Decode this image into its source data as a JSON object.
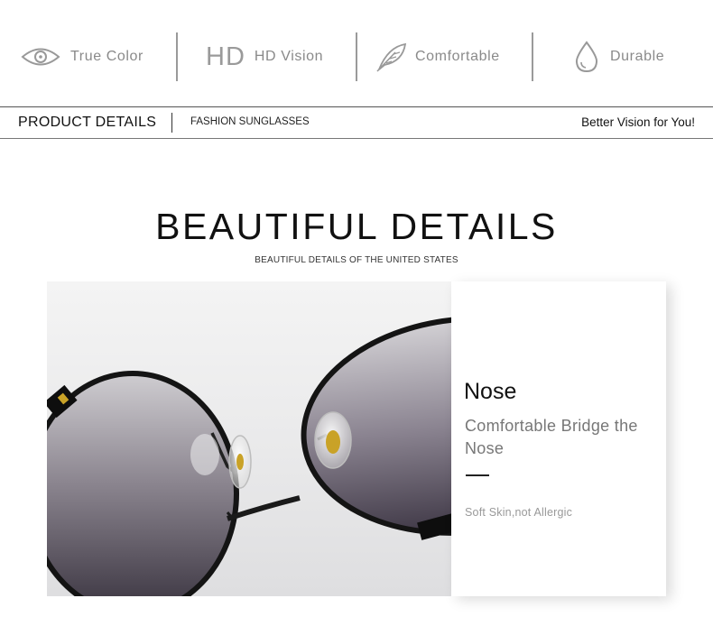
{
  "features": [
    {
      "icon": "eye-icon",
      "label": "True Color"
    },
    {
      "icon": "hd-icon",
      "mark": "HD",
      "label": "HD Vision"
    },
    {
      "icon": "feather-icon",
      "label": "Comfortable"
    },
    {
      "icon": "water-drop-icon",
      "label": "Durable"
    }
  ],
  "bar": {
    "product_details": "PRODUCT DETAILS",
    "category": "FASHION SUNGLASSES",
    "tagline": "Better Vision for You!"
  },
  "section": {
    "title": "BEAUTIFUL DETAILS",
    "subtitle": "BEAUTIFUL DETAILS OF THE UNITED STATES"
  },
  "card": {
    "heading": "Nose",
    "description": "Comfortable Bridge the Nose",
    "note": "Soft Skin,not Allergic"
  },
  "colors": {
    "lens_dark": "#3a3440",
    "lens_light": "#c9c7cc",
    "frame": "#111111",
    "nose_pad_metal": "#c9a227"
  }
}
